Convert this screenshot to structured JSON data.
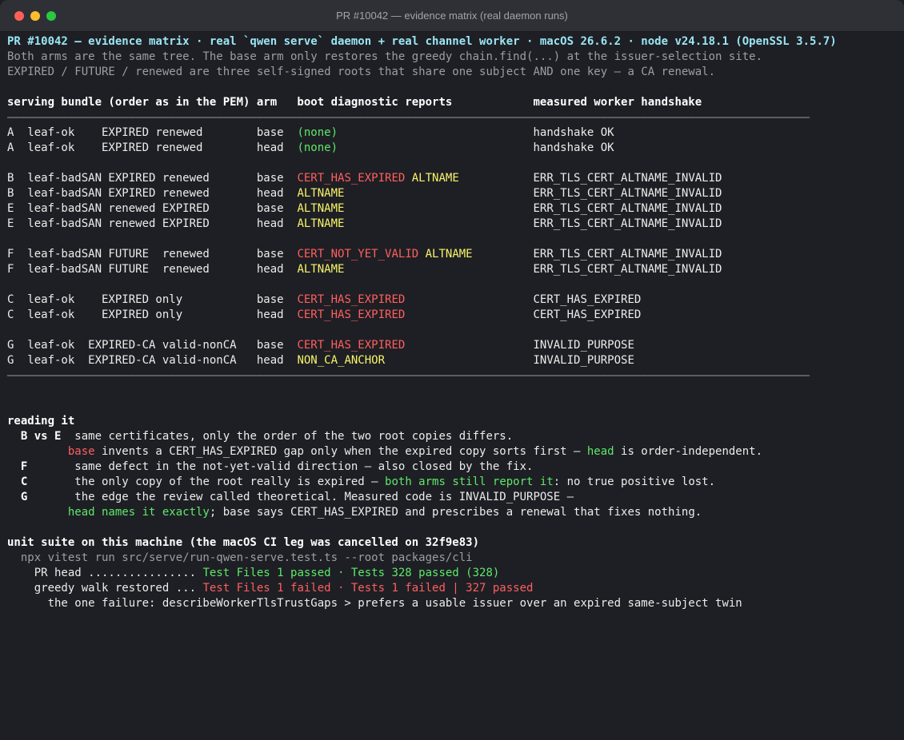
{
  "window": {
    "title": "PR #10042 — evidence matrix (real daemon runs)"
  },
  "header": {
    "line1": "PR #10042 — evidence matrix · real `qwen serve` daemon + real channel worker · macOS 26.6.2 · node v24.18.1 (OpenSSL 3.5.7)",
    "line2": "Both arms are the same tree. The base arm only restores the greedy chain.find(...) at the issuer-selection site.",
    "line3": "EXPIRED / FUTURE / renewed are three self-signed roots that share one subject AND one key — a CA renewal."
  },
  "table": {
    "header": "serving bundle (order as in the PEM) arm   boot diagnostic reports            measured worker handshake",
    "rule": "———————————————————————————————————————————————————————————————————————————————————————————————————————————————————————",
    "rows": [
      {
        "bundle": "A  leaf-ok    EXPIRED renewed        ",
        "arm": "base  ",
        "diag1": "(none)",
        "diag1_color": "green",
        "diag2": "",
        "pad": "                             ",
        "handshake": "handshake OK"
      },
      {
        "bundle": "A  leaf-ok    EXPIRED renewed        ",
        "arm": "head  ",
        "diag1": "(none)",
        "diag1_color": "green",
        "diag2": "",
        "pad": "                             ",
        "handshake": "handshake OK"
      },
      {
        "spacer": true
      },
      {
        "bundle": "B  leaf-badSAN EXPIRED renewed       ",
        "arm": "base  ",
        "diag1": "CERT_HAS_EXPIRED",
        "diag1_color": "red",
        "diag2": " ALTNAME",
        "pad": "           ",
        "handshake": "ERR_TLS_CERT_ALTNAME_INVALID"
      },
      {
        "bundle": "B  leaf-badSAN EXPIRED renewed       ",
        "arm": "head  ",
        "diag1": "ALTNAME",
        "diag1_color": "yellow",
        "diag2": "",
        "pad": "                            ",
        "handshake": "ERR_TLS_CERT_ALTNAME_INVALID"
      },
      {
        "bundle": "E  leaf-badSAN renewed EXPIRED       ",
        "arm": "base  ",
        "diag1": "ALTNAME",
        "diag1_color": "yellow",
        "diag2": "",
        "pad": "                            ",
        "handshake": "ERR_TLS_CERT_ALTNAME_INVALID"
      },
      {
        "bundle": "E  leaf-badSAN renewed EXPIRED       ",
        "arm": "head  ",
        "diag1": "ALTNAME",
        "diag1_color": "yellow",
        "diag2": "",
        "pad": "                            ",
        "handshake": "ERR_TLS_CERT_ALTNAME_INVALID"
      },
      {
        "spacer": true
      },
      {
        "bundle": "F  leaf-badSAN FUTURE  renewed       ",
        "arm": "base  ",
        "diag1": "CERT_NOT_YET_VALID",
        "diag1_color": "red",
        "diag2": " ALTNAME",
        "pad": "         ",
        "handshake": "ERR_TLS_CERT_ALTNAME_INVALID"
      },
      {
        "bundle": "F  leaf-badSAN FUTURE  renewed       ",
        "arm": "head  ",
        "diag1": "ALTNAME",
        "diag1_color": "yellow",
        "diag2": "",
        "pad": "                            ",
        "handshake": "ERR_TLS_CERT_ALTNAME_INVALID"
      },
      {
        "spacer": true
      },
      {
        "bundle": "C  leaf-ok    EXPIRED only           ",
        "arm": "base  ",
        "diag1": "CERT_HAS_EXPIRED",
        "diag1_color": "red",
        "diag2": "",
        "pad": "                   ",
        "handshake": "CERT_HAS_EXPIRED"
      },
      {
        "bundle": "C  leaf-ok    EXPIRED only           ",
        "arm": "head  ",
        "diag1": "CERT_HAS_EXPIRED",
        "diag1_color": "red",
        "diag2": "",
        "pad": "                   ",
        "handshake": "CERT_HAS_EXPIRED"
      },
      {
        "spacer": true
      },
      {
        "bundle": "G  leaf-ok  EXPIRED-CA valid-nonCA   ",
        "arm": "base  ",
        "diag1": "CERT_HAS_EXPIRED",
        "diag1_color": "red",
        "diag2": "",
        "pad": "                   ",
        "handshake": "INVALID_PURPOSE"
      },
      {
        "bundle": "G  leaf-ok  EXPIRED-CA valid-nonCA   ",
        "arm": "head  ",
        "diag1": "NON_CA_ANCHOR",
        "diag1_color": "yellow",
        "diag2": "",
        "pad": "                      ",
        "handshake": "INVALID_PURPOSE"
      }
    ]
  },
  "reading": {
    "title": "reading it",
    "be_label": "  B vs E  ",
    "be_text": "same certificates, only the order of the two root copies differs.",
    "be2_indent": "         ",
    "be2_base": "base",
    "be2_mid": " invents a CERT_HAS_EXPIRED gap only when the expired copy sorts first — ",
    "be2_head": "head",
    "be2_end": " is order-independent.",
    "f_label": "  F       ",
    "f_text": "same defect in the not-yet-valid direction — also closed by the fix.",
    "c_label": "  C       ",
    "c_pre": "the only copy of the root really is expired — ",
    "c_green": "both arms still report it",
    "c_post": ": no true positive lost.",
    "g_label": "  G       ",
    "g_text": "the edge the review called theoretical. Measured code is INVALID_PURPOSE —",
    "g2_indent": "         ",
    "g2_green": "head names it exactly",
    "g2_post": "; base says CERT_HAS_EXPIRED and prescribes a renewal that fixes nothing."
  },
  "unit": {
    "title": "unit suite on this machine (the macOS CI leg was cancelled on 32f9e83)",
    "command": "  npx vitest run src/serve/run-qwen-serve.test.ts --root packages/cli",
    "head_label": "    PR head ................ ",
    "head_result": "Test Files 1 passed · Tests 328 passed (328)",
    "greedy_label": "    greedy walk restored ... ",
    "greedy_result": "Test Files 1 failed · Tests 1 failed | 327 passed",
    "failure": "      the one failure: describeWorkerTlsTrustGaps > prefers a usable issuer over an expired same-subject twin"
  },
  "colors": {
    "green": "#5ee86a",
    "red": "#ff5f5f",
    "yellow": "#f8f56a",
    "cyan": "#9ae5f4"
  }
}
